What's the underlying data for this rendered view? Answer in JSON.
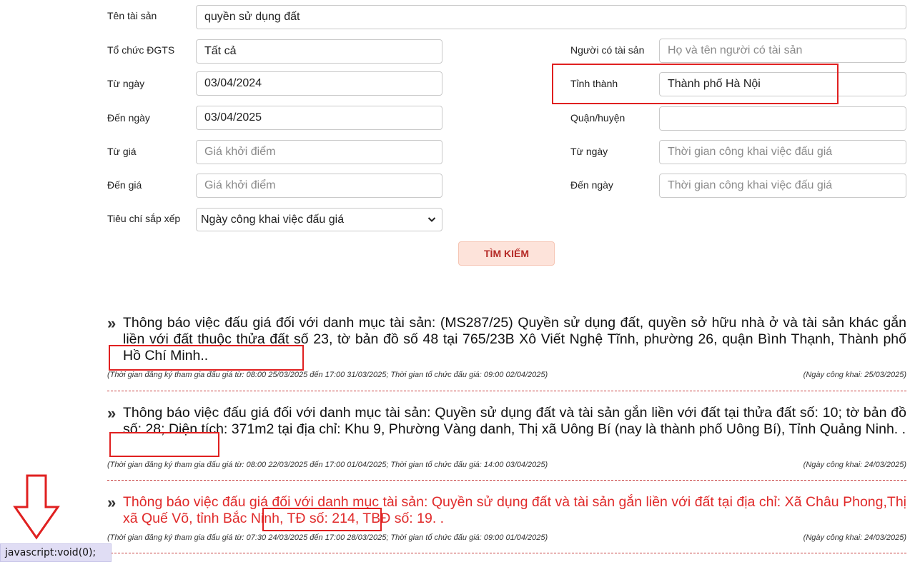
{
  "form": {
    "asset_name": {
      "label": "Tên tài sản",
      "value": "quyền sử dụng đất"
    },
    "org": {
      "label": "Tổ chức ĐGTS",
      "value": "Tất cả"
    },
    "from_date": {
      "label": "Từ ngày",
      "value": "03/04/2024"
    },
    "to_date": {
      "label": "Đến ngày",
      "value": "03/04/2025"
    },
    "from_price": {
      "label": "Từ giá",
      "placeholder": "Giá khởi điểm"
    },
    "to_price": {
      "label": "Đến giá",
      "placeholder": "Giá khởi điểm"
    },
    "sort": {
      "label": "Tiêu chí sắp xếp",
      "value": "Ngày công khai việc đấu giá"
    },
    "owner": {
      "label": "Người có tài sản",
      "placeholder": "Họ và tên người có tài sản"
    },
    "province": {
      "label": "Tỉnh thành",
      "value": "Thành phố Hà Nội"
    },
    "district": {
      "label": "Quận/huyện",
      "value": ""
    },
    "pub_from": {
      "label": "Từ ngày",
      "placeholder": "Thời gian công khai việc đấu giá"
    },
    "pub_to": {
      "label": "Đến ngày",
      "placeholder": "Thời gian công khai việc đấu giá"
    },
    "search_button": "TÌM KIẾM"
  },
  "results": [
    {
      "title": "Thông báo việc đấu giá đối với danh mục tài sản: (MS287/25) Quyền sử dụng đất, quyền sở hữu nhà ở và tài sản khác gắn liền với đất thuộc thửa đất số 23, tờ bản đồ số 48 tại 765/23B Xô Viết Nghệ Tĩnh, phường 26, quận Bình Thạnh, Thành phố Hồ Chí Minh..",
      "meta": "(Thời gian đăng ký tham gia đấu giá từ: 08:00 25/03/2025 đến 17:00 31/03/2025; Thời gian tổ chức đấu giá: 09:00 02/04/2025)",
      "published": "(Ngày công khai: 25/03/2025)",
      "hover": false
    },
    {
      "title": "Thông báo việc đấu giá đối với danh mục tài sản: Quyền sử dụng đất và tài sản gắn liền với đất tại thửa đất số: 10; tờ bản đồ số: 28; Diện tích: 371m2 tại địa chỉ: Khu 9, Phường Vàng danh, Thị xã Uông Bí (nay là thành phố Uông Bí), Tỉnh Quảng Ninh. .",
      "meta": "(Thời gian đăng ký tham gia đấu giá từ: 08:00 22/03/2025 đến 17:00 01/04/2025; Thời gian tổ chức đấu giá: 14:00 03/04/2025)",
      "published": "(Ngày công khai: 24/03/2025)",
      "hover": false
    },
    {
      "title": "Thông báo việc đấu giá đối với danh mục tài sản: Quyền sử dụng đất và tài sản gắn liền với đất tại địa chỉ: Xã Châu Phong,Thị xã Quế Võ, tỉnh Bắc Ninh, TĐ số: 214, TBĐ số: 19. .",
      "meta": "(Thời gian đăng ký tham gia đấu giá từ: 07:30 24/03/2025 đến 17:00 28/03/2025; Thời gian tổ chức đấu giá: 09:00 01/04/2025)",
      "published": "(Ngày công khai: 24/03/2025)",
      "hover": true
    }
  ],
  "status_bar": "javascript:void(0);",
  "icons": {
    "bullet": "double-chevron-right-icon",
    "dropdown": "chevron-down-icon",
    "annotation": "down-arrow-icon"
  },
  "colors": {
    "accent": "#e02a2a",
    "button_bg": "#fde3da",
    "button_text": "#b52a26",
    "annotation": "#e02020"
  }
}
